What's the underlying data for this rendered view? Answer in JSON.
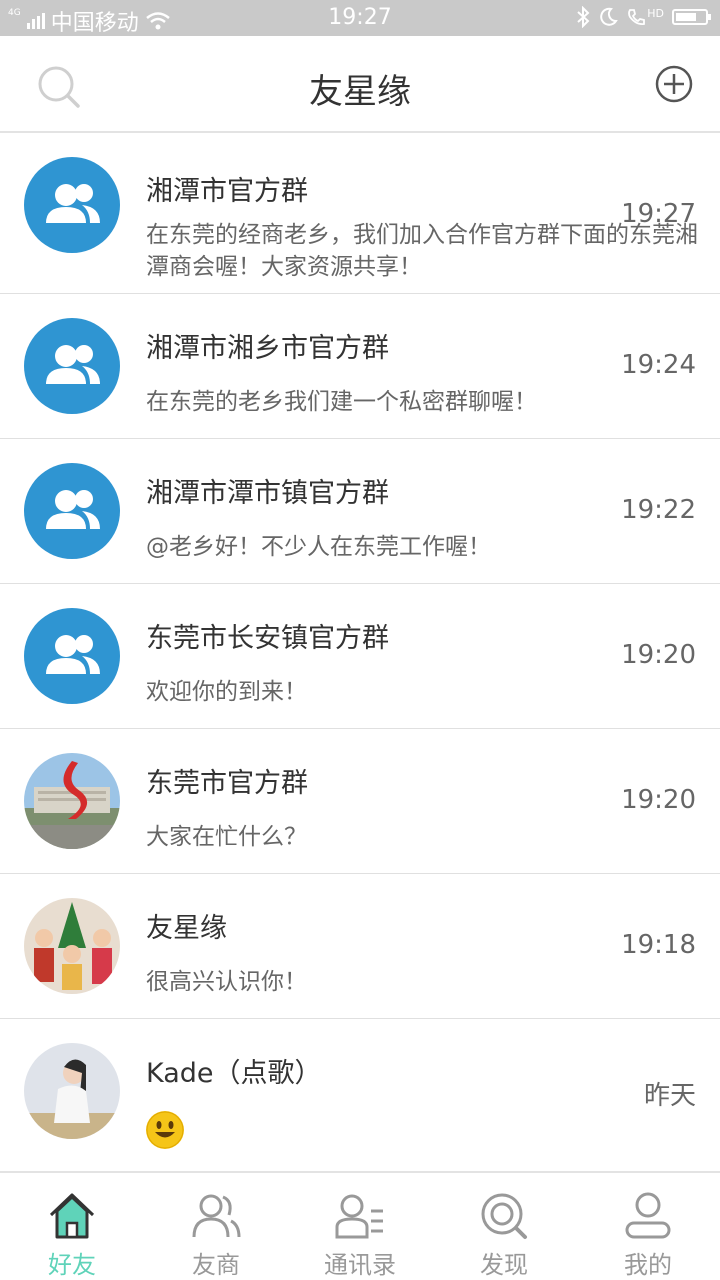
{
  "status_bar": {
    "network": "4G",
    "carrier": "中国移动",
    "time": "19:27",
    "hd_label": "HD",
    "battery_level": 0.7
  },
  "header": {
    "title": "友星缘"
  },
  "conversations": [
    {
      "name": "湘潭市官方群",
      "message": "在东莞的经商老乡，我们加入合作官方群下面的东莞湘潭商会喔！大家资源共享！",
      "time": "19:27",
      "avatar": "group-icon"
    },
    {
      "name": "湘潭市湘乡市官方群",
      "message": "在东莞的老乡我们建一个私密群聊喔！",
      "time": "19:24",
      "avatar": "group-icon"
    },
    {
      "name": "湘潭市潭市镇官方群",
      "message": "@老乡好！不少人在东莞工作喔！",
      "time": "19:22",
      "avatar": "group-icon"
    },
    {
      "name": "东莞市长安镇官方群",
      "message": "欢迎你的到来！",
      "time": "19:20",
      "avatar": "group-icon"
    },
    {
      "name": "东莞市官方群",
      "message": "大家在忙什么？",
      "time": "19:20",
      "avatar": "landmark-photo"
    },
    {
      "name": "友星缘",
      "message": "很高兴认识你！",
      "time": "19:18",
      "avatar": "children-photo"
    },
    {
      "name": "Kade（点歌）",
      "message": "",
      "time": "昨天",
      "avatar": "woman-photo",
      "emoji": "smiling-face-emoji"
    }
  ],
  "tabs": [
    {
      "label": "好友",
      "icon": "home-icon",
      "active": true
    },
    {
      "label": "友商",
      "icon": "users-icon",
      "active": false
    },
    {
      "label": "通讯录",
      "icon": "contacts-icon",
      "active": false
    },
    {
      "label": "发现",
      "icon": "discover-icon",
      "active": false
    },
    {
      "label": "我的",
      "icon": "profile-icon",
      "active": false
    }
  ],
  "colors": {
    "status_bar_bg": "#c9c9c9",
    "group_avatar": "#2f95d2",
    "active_tab": "#5fd3b9",
    "inactive_tab": "#999999"
  }
}
